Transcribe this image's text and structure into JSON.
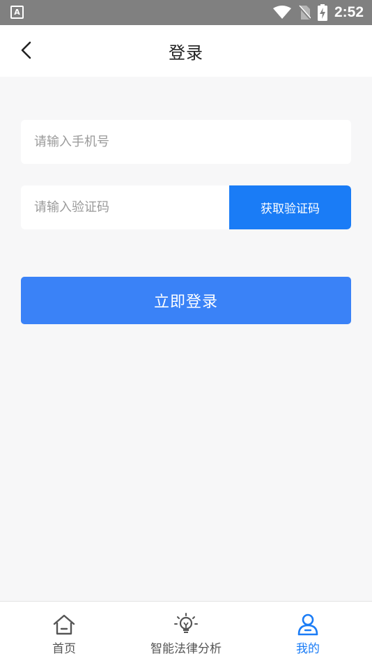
{
  "status_bar": {
    "notification_icon": "a-letter-icon",
    "time": "2:52"
  },
  "header": {
    "back_icon": "chevron-left-icon",
    "title": "登录"
  },
  "form": {
    "phone_placeholder": "请输入手机号",
    "code_placeholder": "请输入验证码",
    "get_code_label": "获取验证码",
    "submit_label": "立即登录"
  },
  "bottom_nav": {
    "items": [
      {
        "label": "首页",
        "icon": "home-icon",
        "active": false
      },
      {
        "label": "智能法律分析",
        "icon": "lightbulb-icon",
        "active": false
      },
      {
        "label": "我的",
        "icon": "user-icon",
        "active": true
      }
    ]
  },
  "colors": {
    "accent": "#1a7cf6",
    "submit_button": "#3a82f7",
    "background": "#f7f7f8",
    "status_bar": "#808080"
  }
}
